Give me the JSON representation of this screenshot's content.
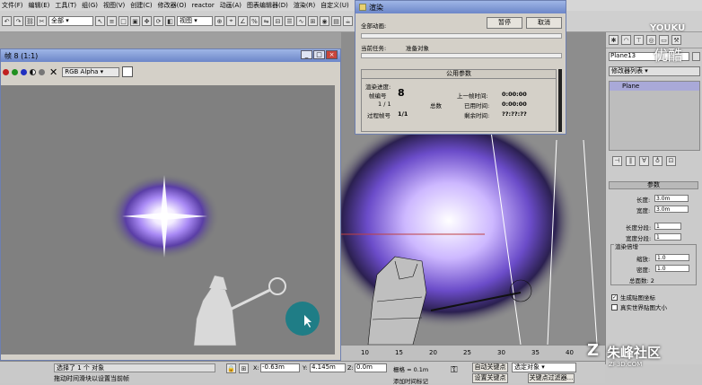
{
  "menu": [
    "文件(F)",
    "编辑(E)",
    "工具(T)",
    "组(G)",
    "视图(V)",
    "创建(C)",
    "修改器(O)",
    "reactor",
    "动画(A)",
    "图表编辑器(D)",
    "渲染(R)",
    "自定义(U)"
  ],
  "toolbar": {
    "filter_select": "全部",
    "view_select": "视图"
  },
  "frame_window": {
    "title": "帧 8 (1:1)",
    "channel_select": "RGB Alpha",
    "icons": [
      "save-icon",
      "copy-icon",
      "clone-icon",
      "print-icon",
      "red-channel-icon",
      "green-channel-icon",
      "blue-channel-icon",
      "alpha-channel-icon",
      "mono-icon",
      "clear-icon"
    ]
  },
  "render_dialog": {
    "title": "渲染",
    "total_anim_label": "全部动画:",
    "pause_button": "暂停",
    "cancel_button": "取消",
    "current_task_label": "当前任务:",
    "current_task_value": "准备对象",
    "section_title": "公用参数",
    "progress_label": "渲染进度:",
    "frame_label": "帧编号",
    "frame_value": "8",
    "frames_done": "1 / 1",
    "total_label": "总数",
    "last_frame_label": "上一帧时间:",
    "last_frame_value": "0:00:00",
    "elapsed_label": "已用时间:",
    "elapsed_value": "0:00:00",
    "process_frame_label": "过程帧号",
    "process_frame_value": "1/1",
    "remaining_label": "剩余时间:",
    "remaining_value": "??:??:??"
  },
  "right_panel": {
    "object_name": "Plane13",
    "modifier_list": "修改器列表",
    "stack_item": "Plane",
    "params_title": "参数",
    "length_label": "长度:",
    "length_value": "3.0m",
    "width_label": "宽度:",
    "width_value": "3.0m",
    "length_segs_label": "长度分段:",
    "length_segs_value": "1",
    "width_segs_label": "宽度分段:",
    "width_segs_value": "1",
    "render_mult_title": "渲染倍增",
    "scale_label": "缩放:",
    "scale_value": "1.0",
    "density_label": "密度:",
    "density_value": "1.0",
    "total_faces": "总面数: 2",
    "gen_mapping": "生成贴图坐标",
    "real_world": "真实世界贴图大小",
    "gen_mapping_checked": true,
    "real_world_checked": false
  },
  "status": {
    "selected": "选择了 1 个 对象",
    "hint": "拖动时间滑块以设置当前帧",
    "x_label": "X:",
    "x_value": "-0.63m",
    "y_label": "Y:",
    "y_value": "4.145m",
    "z_label": "Z:",
    "z_value": "0.0m",
    "grid_label": "栅格 = 0.1m",
    "add_time_tag": "添加时间标记",
    "auto_key": "自动关键点",
    "set_key": "设置关键点",
    "selection_select": "选定对象",
    "key_filter": "关键点过滤器..."
  },
  "timeline": {
    "ticks": [
      "10",
      "15",
      "20",
      "25",
      "30",
      "35",
      "40"
    ]
  },
  "watermarks": {
    "youku": "YOUKU",
    "youku_cn": "优酷",
    "brand": "朱峰社区",
    "brand_url": "ZF3D.COM"
  },
  "colors": {
    "glow": "#9b7dff",
    "cursor_disc": "#1f7d86",
    "title_blue": "#6c86c9"
  }
}
